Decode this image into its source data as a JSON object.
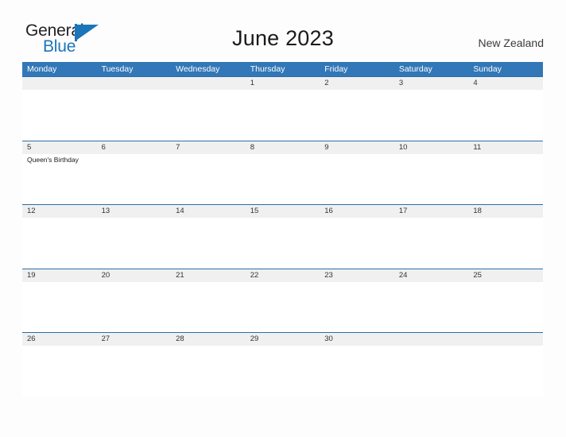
{
  "brand": {
    "name_part1": "General",
    "name_part2": "Blue",
    "colors": {
      "blue": "#1b75bb",
      "dark": "#231f20"
    }
  },
  "header": {
    "title": "June 2023",
    "region": "New Zealand"
  },
  "calendar": {
    "colors": {
      "header_blue": "#3277b7",
      "row_divider": "#2e6da4",
      "day_band": "#f0f0f0"
    },
    "day_names": [
      "Monday",
      "Tuesday",
      "Wednesday",
      "Thursday",
      "Friday",
      "Saturday",
      "Sunday"
    ],
    "weeks": [
      {
        "days": [
          {
            "num": "",
            "event": ""
          },
          {
            "num": "",
            "event": ""
          },
          {
            "num": "",
            "event": ""
          },
          {
            "num": "1",
            "event": ""
          },
          {
            "num": "2",
            "event": ""
          },
          {
            "num": "3",
            "event": ""
          },
          {
            "num": "4",
            "event": ""
          }
        ]
      },
      {
        "days": [
          {
            "num": "5",
            "event": "Queen's Birthday"
          },
          {
            "num": "6",
            "event": ""
          },
          {
            "num": "7",
            "event": ""
          },
          {
            "num": "8",
            "event": ""
          },
          {
            "num": "9",
            "event": ""
          },
          {
            "num": "10",
            "event": ""
          },
          {
            "num": "11",
            "event": ""
          }
        ]
      },
      {
        "days": [
          {
            "num": "12",
            "event": ""
          },
          {
            "num": "13",
            "event": ""
          },
          {
            "num": "14",
            "event": ""
          },
          {
            "num": "15",
            "event": ""
          },
          {
            "num": "16",
            "event": ""
          },
          {
            "num": "17",
            "event": ""
          },
          {
            "num": "18",
            "event": ""
          }
        ]
      },
      {
        "days": [
          {
            "num": "19",
            "event": ""
          },
          {
            "num": "20",
            "event": ""
          },
          {
            "num": "21",
            "event": ""
          },
          {
            "num": "22",
            "event": ""
          },
          {
            "num": "23",
            "event": ""
          },
          {
            "num": "24",
            "event": ""
          },
          {
            "num": "25",
            "event": ""
          }
        ]
      },
      {
        "days": [
          {
            "num": "26",
            "event": ""
          },
          {
            "num": "27",
            "event": ""
          },
          {
            "num": "28",
            "event": ""
          },
          {
            "num": "29",
            "event": ""
          },
          {
            "num": "30",
            "event": ""
          },
          {
            "num": "",
            "event": ""
          },
          {
            "num": "",
            "event": ""
          }
        ]
      }
    ]
  }
}
